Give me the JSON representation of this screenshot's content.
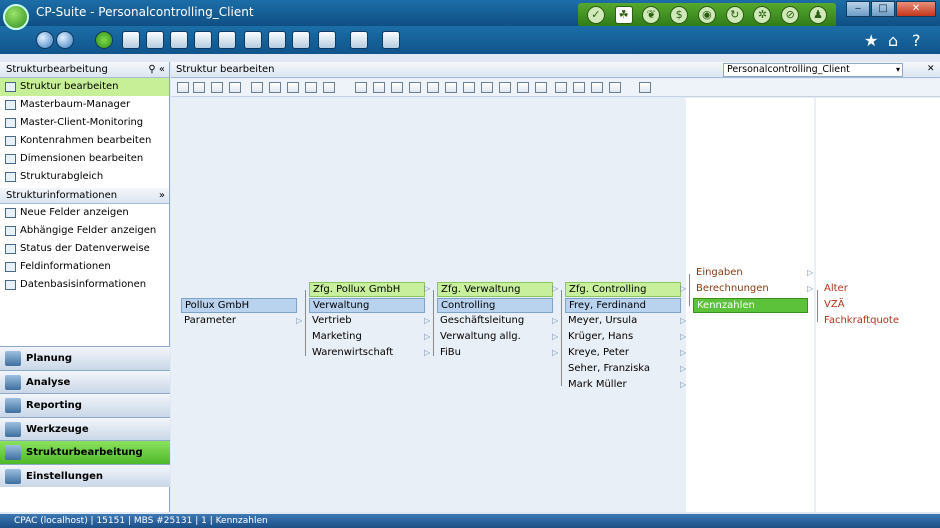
{
  "window": {
    "title": "CP-Suite - Personalcontrolling_Client",
    "min": "‒",
    "max": "□",
    "close": "✕"
  },
  "sidebar": {
    "header": "Strukturbearbeitung",
    "header_icons": "⚲ «",
    "items": [
      {
        "label": "Struktur bearbeiten",
        "selected": true
      },
      {
        "label": "Masterbaum-Manager"
      },
      {
        "label": "Master-Client-Monitoring"
      },
      {
        "label": "Kontenrahmen bearbeiten"
      },
      {
        "label": "Dimensionen bearbeiten"
      },
      {
        "label": "Strukturabgleich"
      }
    ],
    "info_header": "Strukturinformationen",
    "info_icon": "»",
    "info_items": [
      {
        "label": "Neue Felder anzeigen"
      },
      {
        "label": "Abhängige Felder anzeigen"
      },
      {
        "label": "Status der Datenverweise"
      },
      {
        "label": "Feldinformationen"
      },
      {
        "label": "Datenbasisinformationen"
      }
    ],
    "big_nav": [
      {
        "label": "Planung"
      },
      {
        "label": "Analyse"
      },
      {
        "label": "Reporting"
      },
      {
        "label": "Werkzeuge"
      },
      {
        "label": "Strukturbearbeitung",
        "selected": true
      },
      {
        "label": "Einstellungen"
      }
    ]
  },
  "main": {
    "header": "Struktur bearbeiten",
    "combo_value": "Personalcontrolling_Client",
    "combo_arrow": "▾",
    "combo_close": "✕",
    "tree": {
      "col1": [
        "Pollux GmbH",
        "Parameter"
      ],
      "col2": [
        "Zfg. Pollux GmbH",
        "Verwaltung",
        "Vertrieb",
        "Marketing",
        "Warenwirtschaft"
      ],
      "col3": [
        "Zfg. Verwaltung",
        "Controlling",
        "Geschäftsleitung",
        "Verwaltung allg.",
        "FiBu"
      ],
      "col4": [
        "Zfg. Controlling",
        "Frey, Ferdinand",
        "Meyer, Ursula",
        "Krüger, Hans",
        "Kreye, Peter",
        "Seher, Franziska",
        "Mark Müller"
      ],
      "col5": [
        "Eingaben",
        "Berechnungen",
        "Kennzahlen"
      ],
      "col6": [
        "Alter",
        "VZÄ",
        "Fachkraftquote"
      ]
    }
  },
  "status": "CPAC (localhost) | 15151 | MBS #25131 | 1 | Kennzahlen",
  "colors": {
    "accent_green": "#5cc23a",
    "title_blue": "#1c6ea8",
    "node_blue": "#b9d2ee"
  }
}
